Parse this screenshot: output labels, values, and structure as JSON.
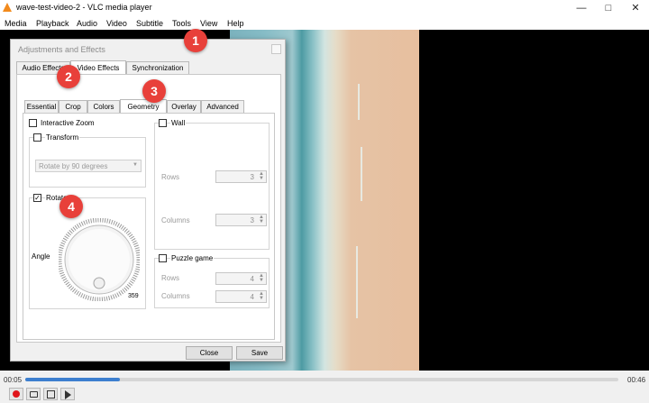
{
  "window": {
    "title": "wave-test-video-2 - VLC media player",
    "min_icon": "minimize-icon",
    "max_icon": "maximize-icon",
    "close_icon": "close-icon"
  },
  "menu": [
    "Media",
    "Playback",
    "Audio",
    "Video",
    "Subtitle",
    "Tools",
    "View",
    "Help"
  ],
  "dialog": {
    "title": "Adjustments and Effects",
    "main_tabs": [
      "Audio Effects",
      "Video Effects",
      "Synchronization"
    ],
    "sub_tabs": [
      "Essential",
      "Crop",
      "Colors",
      "Geometry",
      "Overlay",
      "Advanced"
    ],
    "interactive_zoom": "Interactive Zoom",
    "transform": "Transform",
    "transform_select": "Rotate by 90 degrees",
    "rotate": "Rotate",
    "angle_label": "Angle",
    "angle_value": "359",
    "wall": "Wall",
    "rows_label": "Rows",
    "rows_value": "3",
    "columns_label": "Columns",
    "columns_value": "3",
    "puzzle": "Puzzle game",
    "puzzle_rows_label": "Rows",
    "puzzle_rows_value": "4",
    "puzzle_columns_label": "Columns",
    "puzzle_columns_value": "4",
    "close_button": "Close",
    "save_button": "Save"
  },
  "badges": [
    "1",
    "2",
    "3",
    "4"
  ],
  "player": {
    "elapsed": "00:05",
    "total": "00:46",
    "progress": 0.16
  },
  "colors": {
    "accent": "#3d7fcf",
    "badge": "#e8403a",
    "record": "#e0151b"
  }
}
